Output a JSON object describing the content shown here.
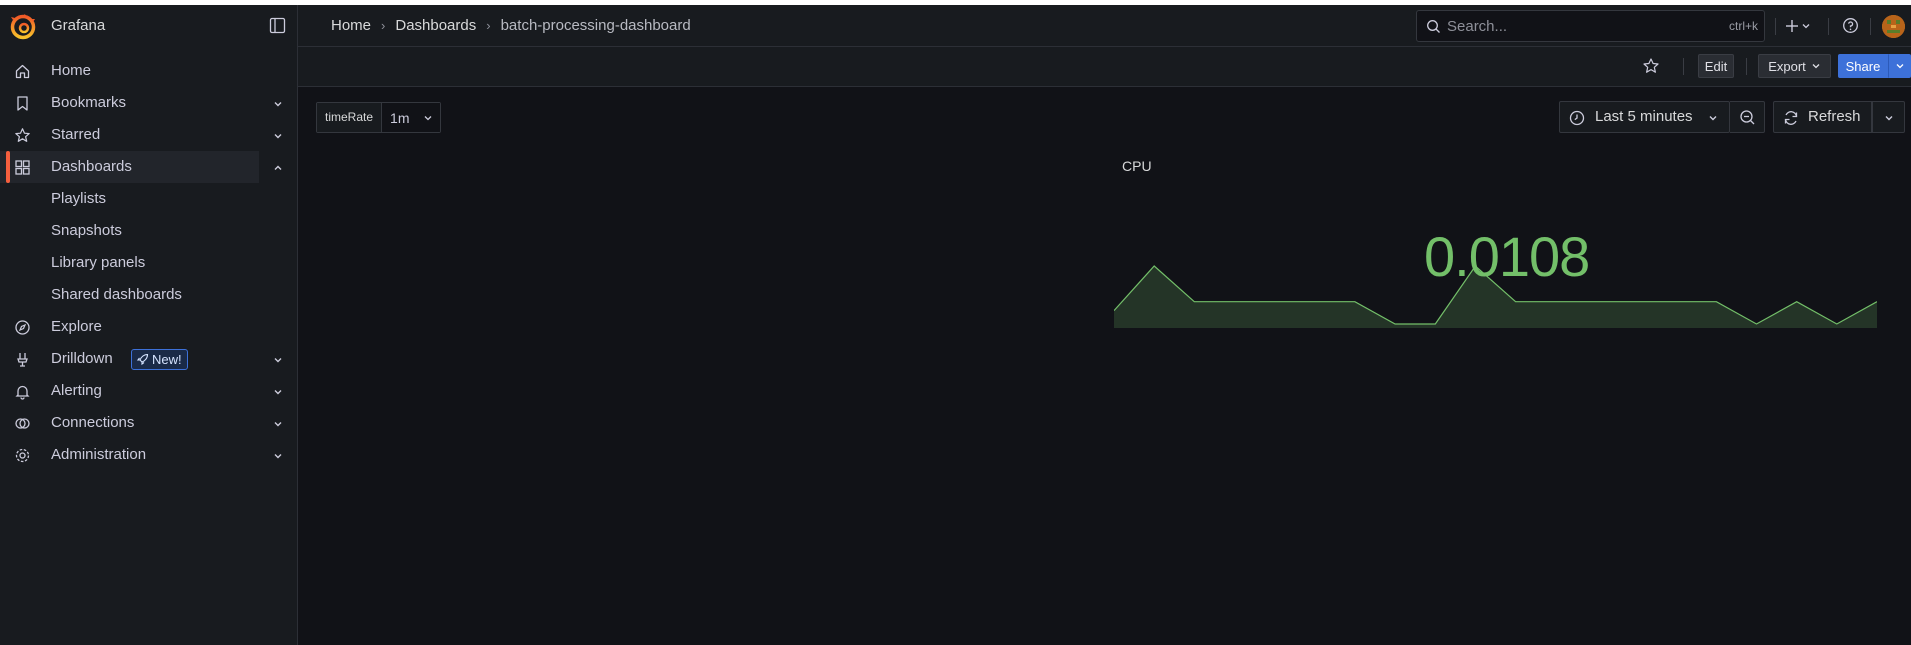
{
  "app": {
    "name": "Grafana"
  },
  "sidebar": {
    "items": [
      {
        "label": "Home",
        "icon": "home-icon",
        "expandable": false
      },
      {
        "label": "Bookmarks",
        "icon": "bookmark-icon",
        "expandable": true
      },
      {
        "label": "Starred",
        "icon": "star-icon",
        "expandable": true
      },
      {
        "label": "Dashboards",
        "icon": "apps-icon",
        "expandable": true,
        "active": true
      },
      {
        "label": "Playlists",
        "sub": true
      },
      {
        "label": "Snapshots",
        "sub": true
      },
      {
        "label": "Library panels",
        "sub": true
      },
      {
        "label": "Shared dashboards",
        "sub": true
      },
      {
        "label": "Explore",
        "icon": "compass-icon",
        "expandable": false
      },
      {
        "label": "Drilldown",
        "icon": "drilldown-icon",
        "expandable": true,
        "badge": "New!"
      },
      {
        "label": "Alerting",
        "icon": "bell-icon",
        "expandable": true
      },
      {
        "label": "Connections",
        "icon": "link-icon",
        "expandable": true
      },
      {
        "label": "Administration",
        "icon": "gear-icon",
        "expandable": true
      }
    ]
  },
  "breadcrumb": [
    "Home",
    "Dashboards",
    "batch-processing-dashboard"
  ],
  "search": {
    "placeholder": "Search...",
    "shortcut": "ctrl+k"
  },
  "actions": {
    "edit": "Edit",
    "export": "Export",
    "share": "Share"
  },
  "variables": [
    {
      "name": "timeRate",
      "value": "1m"
    }
  ],
  "time_picker": {
    "range": "Last 5 minutes",
    "refresh": "Refresh"
  },
  "panel": {
    "title": "CPU",
    "value": "0.0108",
    "color": "#73bf69",
    "sparkline": [
      1,
      2,
      1.2,
      1.2,
      1.2,
      1.2,
      1.2,
      0.7,
      0.7,
      2,
      1.2,
      1.2,
      1.2,
      1.2,
      1.2,
      1.2,
      0.7,
      1.2,
      0.7,
      1.2
    ]
  },
  "colors": {
    "accent": "#f55f3e",
    "primary": "#3d71d9",
    "stat": "#73bf69"
  }
}
